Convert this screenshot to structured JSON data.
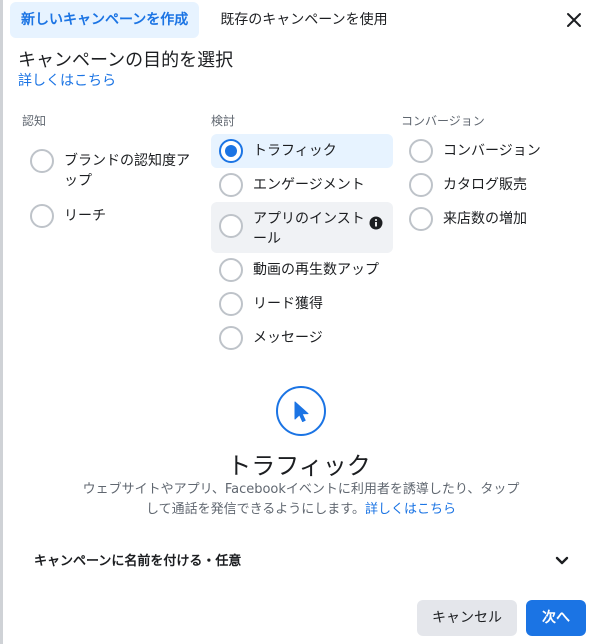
{
  "tabs": {
    "create_new": "新しいキャンペーンを作成",
    "use_existing": "既存のキャンペーンを使用"
  },
  "close_icon": "close-icon",
  "heading": "キャンペーンの目的を選択",
  "learn_more": "詳しくはこちら",
  "columns": [
    {
      "title": "認知",
      "options": [
        {
          "label": "ブランドの認知度アップ",
          "selected": false
        },
        {
          "label": "リーチ",
          "selected": false
        }
      ]
    },
    {
      "title": "検討",
      "options": [
        {
          "label": "トラフィック",
          "selected": true
        },
        {
          "label": "エンゲージメント",
          "selected": false
        },
        {
          "label": "アプリのインストール",
          "selected": false,
          "info_icon": "info-icon"
        },
        {
          "label": "動画の再生数アップ",
          "selected": false
        },
        {
          "label": "リード獲得",
          "selected": false
        },
        {
          "label": "メッセージ",
          "selected": false
        }
      ]
    },
    {
      "title": "コンバージョン",
      "options": [
        {
          "label": "コンバージョン",
          "selected": false
        },
        {
          "label": "カタログ販売",
          "selected": false
        },
        {
          "label": "来店数の増加",
          "selected": false
        }
      ]
    }
  ],
  "preview": {
    "icon": "cursor-icon",
    "title": "トラフィック",
    "description": "ウェブサイトやアプリ、Facebookイベントに利用者を誘導したり、タップして通話を発信できるようにします。",
    "link": "詳しくはこちら"
  },
  "naming": {
    "label": "キャンペーンに名前を付ける・任意",
    "icon": "chevron-down-icon"
  },
  "footer": {
    "cancel": "キャンセル",
    "next": "次へ"
  },
  "colors": {
    "accent": "#1b74e4",
    "selected_bg": "#e7f3ff",
    "hover_bg": "#f0f2f5"
  }
}
